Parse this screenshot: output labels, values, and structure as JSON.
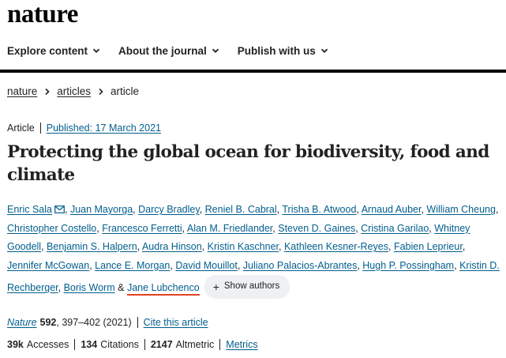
{
  "site": {
    "logo": "nature"
  },
  "nav": {
    "items": [
      {
        "label": "Explore content"
      },
      {
        "label": "About the journal"
      },
      {
        "label": "Publish with us"
      }
    ]
  },
  "breadcrumb": {
    "items": [
      "nature",
      "articles"
    ],
    "current": "article"
  },
  "article": {
    "type": "Article",
    "published": "Published: 17 March 2021",
    "title": "Protecting the global ocean for biodiversity, food and climate",
    "authors": [
      "Enric Sala",
      "Juan Mayorga",
      "Darcy Bradley",
      "Reniel B. Cabral",
      "Trisha B. Atwood",
      "Arnaud Auber",
      "William Cheung",
      "Christopher Costello",
      "Francesco Ferretti",
      "Alan M. Friedlander",
      "Steven D. Gaines",
      "Cristina Garilao",
      "Whitney Goodell",
      "Benjamin S. Halpern",
      "Audra Hinson",
      "Kristin Kaschner",
      "Kathleen Kesner-Reyes",
      "Fabien Leprieur",
      "Jennifer McGowan",
      "Lance E. Morgan",
      "David Mouillot",
      "Juliano Palacios-Abrantes",
      "Hugh P. Possingham",
      "Kristin D. Rechberger",
      "Boris Worm"
    ],
    "last_author": "Jane Lubchenco",
    "ampersand": "&",
    "show_authors": "Show authors",
    "journal": "Nature",
    "volume": "592",
    "pages_year": ", 397–402 (2021)",
    "cite_label": "Cite this article",
    "accesses_value": "39k",
    "accesses_label": "Accesses",
    "citations_value": "134",
    "citations_label": "Citations",
    "altmetric_value": "2147",
    "altmetric_label": "Altmetric",
    "metrics_label": "Metrics"
  },
  "icons": {
    "chevron": "chevron-down-icon",
    "breadcrumb_sep": "chevron-right-icon",
    "mail": "mail-icon",
    "plus": "plus-icon"
  },
  "colors": {
    "link": "#025e8d",
    "accent_underline": "#e0431f",
    "pill_bg": "#eef0f3"
  }
}
